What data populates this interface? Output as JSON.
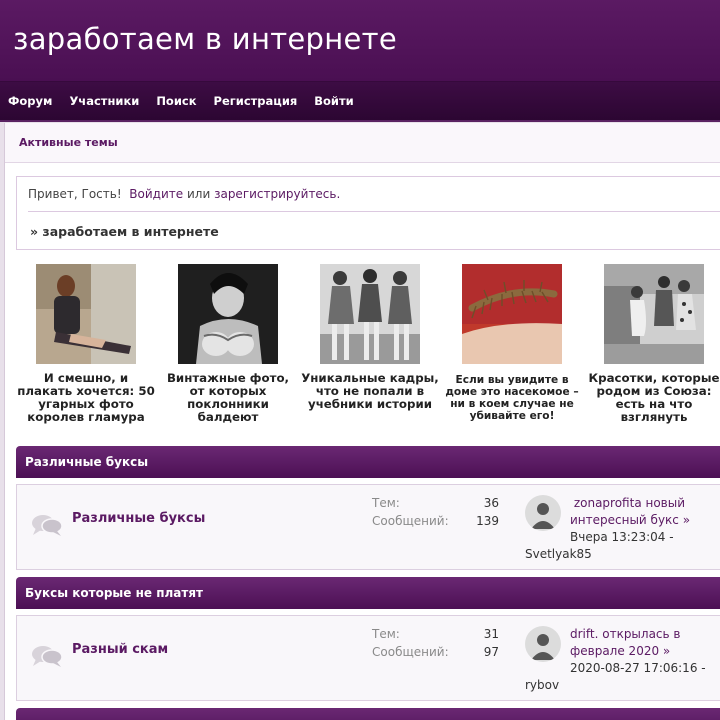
{
  "site": {
    "title": "заработаем в интернете"
  },
  "nav": [
    {
      "label": "Форум"
    },
    {
      "label": "Участники"
    },
    {
      "label": "Поиск"
    },
    {
      "label": "Регистрация"
    },
    {
      "label": "Войти"
    }
  ],
  "breadcrumb": {
    "label": "Активные темы"
  },
  "welcome": {
    "greeting": "Привет, Гость!",
    "login_link": "Войдите",
    "or": "или",
    "register_link": "зарегистрируйтесь.",
    "forum_title": "» заработаем в интернете"
  },
  "teasers": [
    {
      "caption": "И смешно, и плакать хочется: 50 угарных фото королев гламура"
    },
    {
      "caption": "Винтажные фото, от которых поклонники балдеют"
    },
    {
      "caption": "Уникальные кадры, что не попали в учебники истории"
    },
    {
      "caption": "Если вы увидите в доме это насекомое – ни в коем случае не убивайте его!"
    },
    {
      "caption": "Красотки, которые родом из Союза: есть на что взглянуть"
    }
  ],
  "categories": [
    {
      "title": "Различные буксы",
      "board": {
        "name": "Различные буксы",
        "topics_label": "Тем:",
        "topics": "36",
        "posts_label": "Сообщений:",
        "posts": "139",
        "last_topic": "zonaprofita новый интересный букс",
        "arrow": "»",
        "last_time": "Вчера 13:23:04 -",
        "last_user": "Svetlyak85"
      }
    },
    {
      "title": "Буксы которые не платят",
      "board": {
        "name": "Разный скам",
        "topics_label": "Тем:",
        "topics": "31",
        "posts_label": "Сообщений:",
        "posts": "97",
        "last_topic": "drift. открылась в феврале 2020",
        "arrow": "»",
        "last_time": "2020-08-27 17:06:16 -",
        "last_user": "rybov"
      }
    }
  ],
  "colors": {
    "header": "#4a0f52",
    "nav": "#2c0632",
    "accent": "#5b1a63"
  }
}
